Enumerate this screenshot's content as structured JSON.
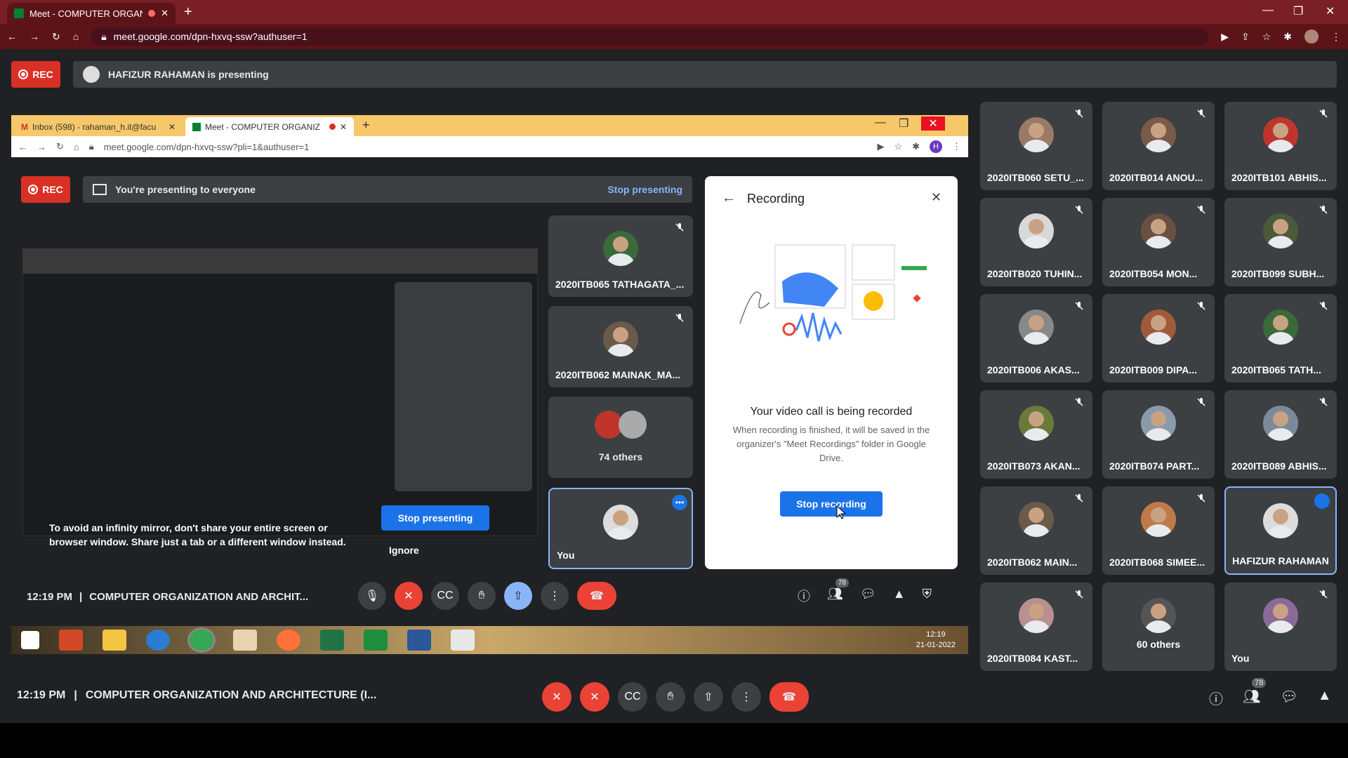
{
  "browser": {
    "tab_title": "Meet - COMPUTER ORGANIZ",
    "url": "meet.google.com/dpn-hxvq-ssw?authuser=1"
  },
  "meet": {
    "rec_label": "REC",
    "presenting_banner": "HAFIZUR RAHAMAN is presenting"
  },
  "inner": {
    "tabs": [
      "Inbox (598) - rahaman_h.it@facu",
      "Meet - COMPUTER ORGANIZ"
    ],
    "url": "meet.google.com/dpn-hxvq-ssw?pli=1&authuser=1",
    "rec_label": "REC",
    "presenting_text": "You're presenting to everyone",
    "stop_presenting_link": "Stop presenting",
    "infinity_warning": "To avoid an infinity mirror, don't share your entire screen or browser window. Share just a tab or a different window instead.",
    "stop_presenting_button": "Stop presenting",
    "ignore": "Ignore",
    "tiles": [
      {
        "name": "2020ITB065 TATHAGATA_..."
      },
      {
        "name": "2020ITB062 MAINAK_MA..."
      },
      {
        "name": "74 others"
      },
      {
        "name": "You"
      }
    ],
    "time": "12:19 PM",
    "meeting_title": "COMPUTER ORGANIZATION AND ARCHIT...",
    "participants_badge": "78",
    "taskbar_time": "12:19",
    "taskbar_date": "21-01-2022"
  },
  "recording_panel": {
    "title": "Recording",
    "heading": "Your video call is being recorded",
    "body": "When recording is finished, it will be saved in the organizer's \"Meet Recordings\" folder in Google Drive.",
    "button": "Stop recording"
  },
  "grid": [
    {
      "name": "2020ITB060 SETU_...",
      "color": "#9a7a66"
    },
    {
      "name": "2020ITB014 ANOU...",
      "color": "#7a5a4a"
    },
    {
      "name": "2020ITB101 ABHIS...",
      "color": "#c0352b"
    },
    {
      "name": "2020ITB020 TUHIN...",
      "color": "#d8d8d8"
    },
    {
      "name": "2020ITB054 MON...",
      "color": "#6a5040"
    },
    {
      "name": "2020ITB099 SUBH...",
      "color": "#4a5a3a"
    },
    {
      "name": "2020ITB006 AKAS...",
      "color": "#888888"
    },
    {
      "name": "2020ITB009 DIPA...",
      "color": "#a05a3a"
    },
    {
      "name": "2020ITB065 TATH...",
      "color": "#3a6a3a"
    },
    {
      "name": "2020ITB073 AKAN...",
      "color": "#6a7a3a"
    },
    {
      "name": "2020ITB074 PART...",
      "color": "#8a9aaa"
    },
    {
      "name": "2020ITB089 ABHIS...",
      "color": "#7a8a9a"
    },
    {
      "name": "2020ITB062 MAIN...",
      "color": "#6a5a4a"
    },
    {
      "name": "2020ITB068 SIMEE...",
      "color": "#c07a4a"
    },
    {
      "name": "HAFIZUR RAHAMAN",
      "color": "#dcdcdc"
    },
    {
      "name": "2020ITB084 KAST...",
      "color": "#b89090"
    },
    {
      "name": "60 others",
      "color": "#555555"
    },
    {
      "name": "You",
      "color": "#8a6a9a"
    }
  ],
  "bottom": {
    "time": "12:19 PM",
    "meeting_title": "COMPUTER ORGANIZATION AND ARCHITECTURE (I...",
    "participants_badge": "78"
  }
}
